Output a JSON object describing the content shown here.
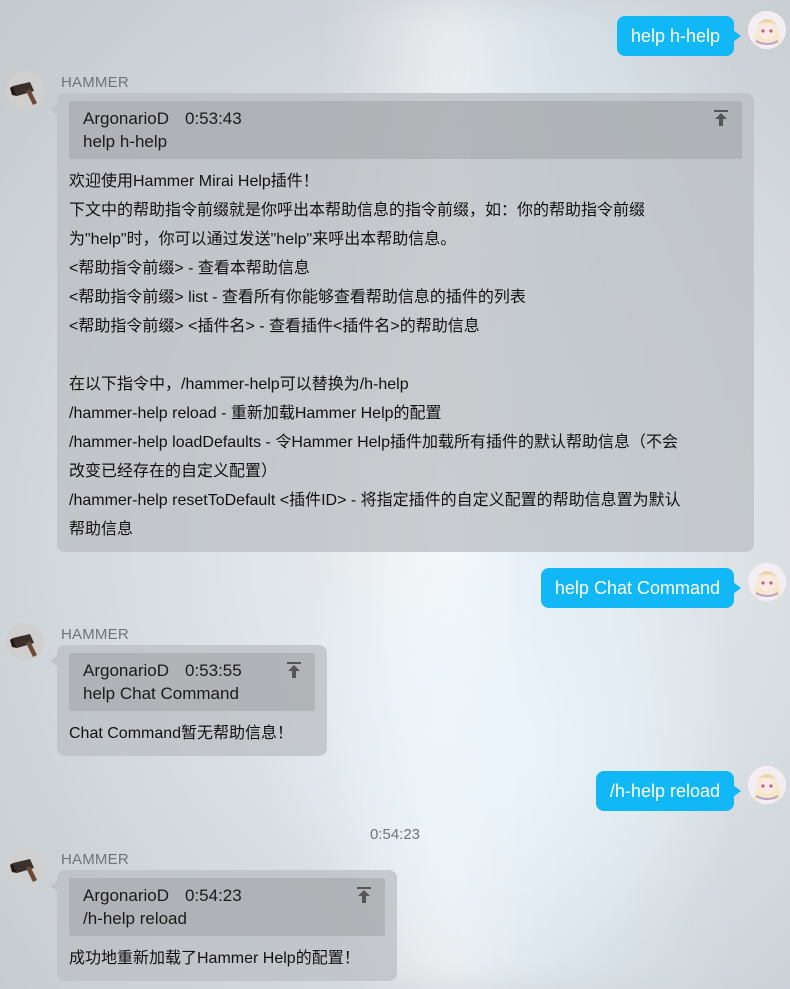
{
  "messages": [
    {
      "self": "help h-help"
    },
    {
      "sender": "HAMMER",
      "quote": {
        "author": "ArgonarioD",
        "time": "0:53:43",
        "text": "help h-help"
      },
      "lines": [
        "欢迎使用Hammer Mirai Help插件！",
        "下文中的帮助指令前缀就是你呼出本帮助信息的指令前缀，如：你的帮助指令前缀",
        "为\"help\"时，你可以通过发送\"help\"来呼出本帮助信息。",
        "<帮助指令前缀> - 查看本帮助信息",
        "<帮助指令前缀> list - 查看所有你能够查看帮助信息的插件的列表",
        "<帮助指令前缀> <插件名> - 查看插件<插件名>的帮助信息",
        "",
        "在以下指令中，/hammer-help可以替换为/h-help",
        "/hammer-help reload - 重新加载Hammer Help的配置",
        "/hammer-help loadDefaults - 令Hammer Help插件加载所有插件的默认帮助信息（不会",
        "改变已经存在的自定义配置）",
        "/hammer-help resetToDefault <插件ID> - 将指定插件的自定义配置的帮助信息置为默认",
        "帮助信息"
      ]
    },
    {
      "self": "help Chat Command"
    },
    {
      "sender": "HAMMER",
      "quote": {
        "author": "ArgonarioD",
        "time": "0:53:55",
        "text": "help Chat Command"
      },
      "lines": [
        "Chat Command暂无帮助信息！"
      ]
    },
    {
      "self": "/h-help reload"
    },
    {
      "timestamp": "0:54:23"
    },
    {
      "sender": "HAMMER",
      "quote": {
        "author": "ArgonarioD",
        "time": "0:54:23",
        "text": "/h-help reload"
      },
      "lines": [
        "成功地重新加载了Hammer Help的配置！"
      ]
    }
  ],
  "icons": {
    "quote_jump": "scroll-to-top-icon",
    "bot_avatar": "hammer-avatar",
    "user_avatar": "anime-avatar"
  },
  "colors": {
    "self_bubble": "#12b7f5",
    "bot_bubble": "#bcc0c4",
    "name_text": "#6f7479"
  }
}
